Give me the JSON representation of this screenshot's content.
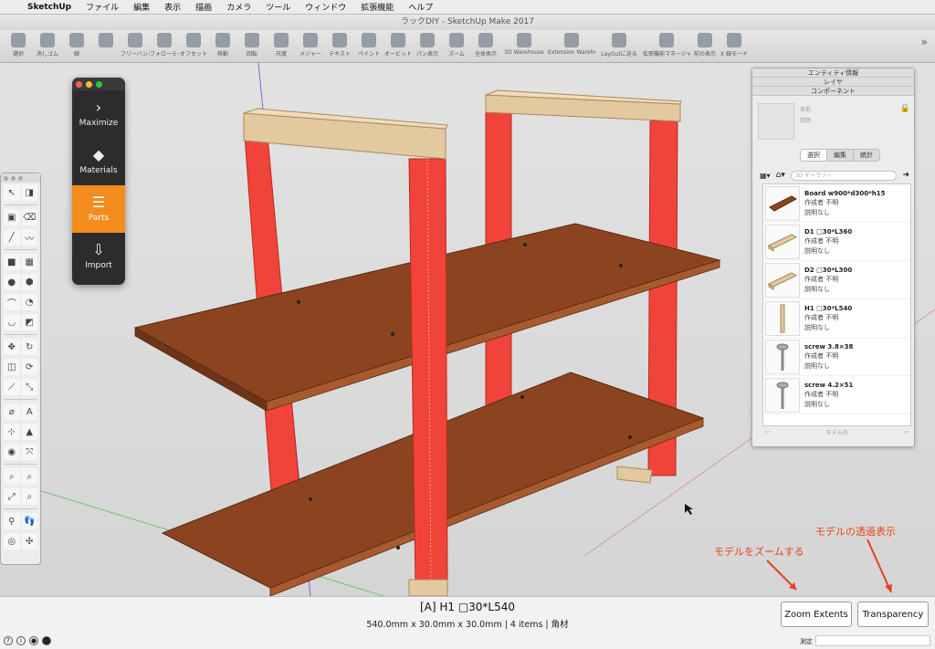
{
  "menubar": {
    "app": "SketchUp",
    "items": [
      "ファイル",
      "編集",
      "表示",
      "描画",
      "カメラ",
      "ツール",
      "ウィンドウ",
      "拡張機能",
      "ヘルプ"
    ]
  },
  "window": {
    "title": "ラックDIY - SketchUp Make 2017"
  },
  "toolbar": {
    "items": [
      {
        "label": "選択",
        "icon": "select-arrow-icon"
      },
      {
        "label": "消しゴム",
        "icon": "eraser-icon"
      },
      {
        "label": "線",
        "icon": "pencil-icon"
      },
      {
        "label": "",
        "icon": "rectangle-icon"
      },
      {
        "label": "フリーハンド",
        "icon": "freehand-icon"
      },
      {
        "label": "フォローミー",
        "icon": "follow-me-icon"
      },
      {
        "label": "オフセット",
        "icon": "offset-icon"
      },
      {
        "label": "移動",
        "icon": "move-icon"
      },
      {
        "label": "回転",
        "icon": "rotate-icon"
      },
      {
        "label": "尺度",
        "icon": "scale-icon"
      },
      {
        "label": "メジャー",
        "icon": "tape-measure-icon"
      },
      {
        "label": "テキスト",
        "icon": "text-icon"
      },
      {
        "label": "ペイント",
        "icon": "paint-bucket-icon"
      },
      {
        "label": "オービット",
        "icon": "orbit-icon"
      },
      {
        "label": "パン表示",
        "icon": "pan-icon"
      },
      {
        "label": "ズーム",
        "icon": "zoom-icon"
      },
      {
        "label": "全体表示",
        "icon": "zoom-extents-icon"
      },
      {
        "label": "3D Warehouse",
        "icon": "warehouse-icon"
      },
      {
        "label": "Extension Warehouse",
        "icon": "extension-warehouse-icon"
      },
      {
        "label": "LayOutに送る",
        "icon": "layout-icon"
      },
      {
        "label": "拡張機能マネージャー",
        "icon": "extension-manager-icon"
      },
      {
        "label": "前の表示",
        "icon": "previous-view-icon"
      },
      {
        "label": "X 線モード",
        "icon": "xray-icon"
      }
    ],
    "more": "»"
  },
  "parts_panel": {
    "items": [
      {
        "label": "Maximize",
        "glyph": "›",
        "active": false
      },
      {
        "label": "Materials",
        "glyph": "◆",
        "active": false
      },
      {
        "label": "Parts",
        "glyph": "☰",
        "active": true
      },
      {
        "label": "Import",
        "glyph": "⇩",
        "active": false
      }
    ]
  },
  "tool_palette": {
    "rows": [
      [
        "↖",
        "◨"
      ],
      [
        "▣",
        "⌫"
      ],
      [
        "╱",
        "〰"
      ],
      [
        "■",
        "▦"
      ],
      [
        "●",
        "⬢"
      ],
      [
        "⌒",
        "◔"
      ],
      [
        "◡",
        "◩"
      ],
      [
        "✥",
        "↻"
      ],
      [
        "◫",
        "⟳"
      ],
      [
        "⟋",
        "⤡"
      ],
      [
        "⌀",
        "A"
      ],
      [
        "⊹",
        "▲"
      ],
      [
        "◉",
        "⤧"
      ],
      [
        "⌕",
        "⌕"
      ],
      [
        "⤢",
        "⌕"
      ],
      [
        "⚲",
        "👣"
      ],
      [
        "◎",
        "✣"
      ]
    ]
  },
  "tray": {
    "headers": [
      "エンティティ情報",
      "レイヤ",
      "コンポーネント"
    ],
    "component": {
      "name_placeholder": "名前",
      "desc_placeholder": "説明",
      "tabs": [
        "選択",
        "編集",
        "統計"
      ],
      "search_placeholder": "3D ギャラリー",
      "items": [
        {
          "name": "Board w900*d300*h15",
          "author": "作成者 不明",
          "desc": "説明なし",
          "thumb": "board"
        },
        {
          "name": "D1 □30*L360",
          "author": "作成者 不明",
          "desc": "説明なし",
          "thumb": "beam"
        },
        {
          "name": "D2 □30*L300",
          "author": "作成者 不明",
          "desc": "説明なし",
          "thumb": "beam"
        },
        {
          "name": "H1 □30*L540",
          "author": "作成者 不明",
          "desc": "説明なし",
          "thumb": "post"
        },
        {
          "name": "screw 3.8×38",
          "author": "作成者 不明",
          "desc": "説明なし",
          "thumb": "screw"
        },
        {
          "name": "screw 4.2×51",
          "author": "作成者 不明",
          "desc": "説明なし",
          "thumb": "screw"
        }
      ],
      "footer": "モデル内"
    }
  },
  "status": {
    "selection_title": "[A] H1 □30*L540",
    "selection_info": "540.0mm x 30.0mm x 30.0mm | 4 items | 角材",
    "zoom_extents": "Zoom Extents",
    "transparency": "Transparency",
    "measure_label": "測定"
  },
  "annotations": {
    "zoom_note": "モデルをズームする",
    "transparency_note": "モデルの透過表示",
    "accent": "#e8421a"
  },
  "colors": {
    "selected_post": "#f0443a",
    "board_top": "#8c4420",
    "wood_light": "#e3c9a0",
    "parts_active": "#f28c1c"
  }
}
